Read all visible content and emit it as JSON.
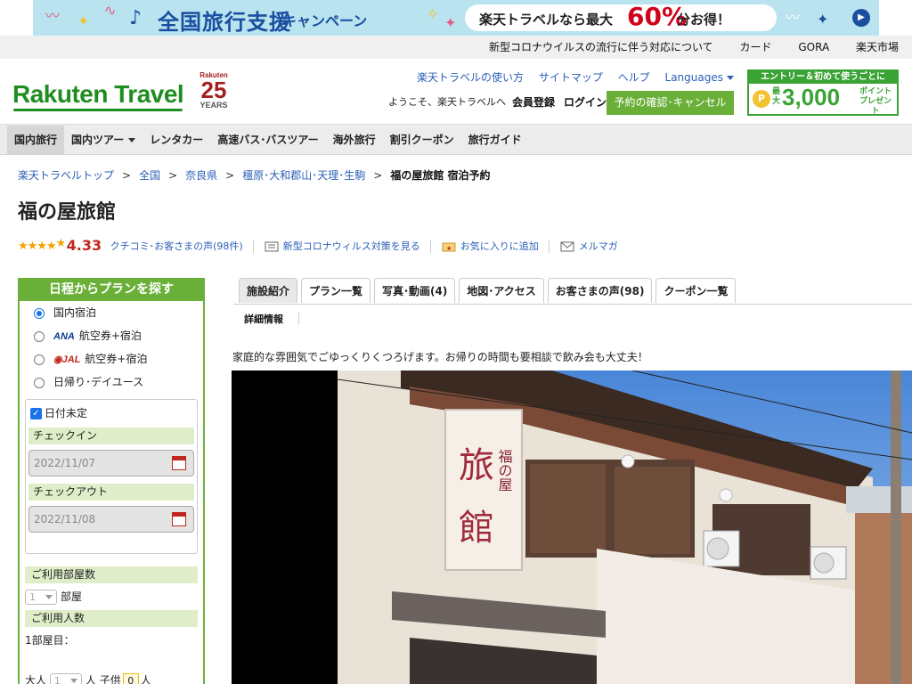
{
  "banner": {
    "title": "全国旅行支援",
    "campaign": "キャンペーン",
    "pill_prefix": "楽天トラベルなら最大",
    "pill_percent": "60%",
    "pill_suffix": "分お得！"
  },
  "toplinks": [
    "新型コロナウイルスの流行に伴う対応について",
    "カード",
    "GORA",
    "楽天市場"
  ],
  "header": {
    "logo": "Rakuten Travel",
    "years_brand": "Rakuten",
    "years_number": "25",
    "years_label": "YEARS",
    "links": [
      "楽天トラベルの使い方",
      "サイトマップ",
      "ヘルプ",
      "Languages"
    ],
    "welcome": "ようこそ、楽天トラベルへ",
    "register": "会員登録",
    "login": "ログイン",
    "confirm_button": "予約の確認･キャンセル",
    "promo_top": "エントリー＆初めて使うごとに",
    "promo_small1": "最大",
    "promo_amount": "3,000",
    "promo_small2": "ポイントプレゼント"
  },
  "nav": [
    "国内旅行",
    "国内ツアー",
    "レンタカー",
    "高速バス･バスツアー",
    "海外旅行",
    "割引クーポン",
    "旅行ガイド"
  ],
  "breadcrumb": [
    "楽天トラベルトップ",
    "全国",
    "奈良県",
    "橿原･大和郡山･天理･生駒"
  ],
  "breadcrumb_current": "福の屋旅館 宿泊予約",
  "hotel": {
    "name": "福の屋旅館",
    "score": "4.33",
    "rating_fraction": 0.866,
    "reviews_link": "クチコミ･お客さまの声(98件)",
    "covid_link": "新型コロナウィルス対策を見る",
    "favorite_link": "お気に入りに追加",
    "mailmag_link": "メルマガ",
    "catchphrase": "家庭的な雰囲気でごゆっくりくつろげます。お帰りの時間も要相談で飲み会も大丈夫！"
  },
  "sidebar": {
    "title": "日程からプランを探す",
    "options": [
      {
        "label": "国内宿泊",
        "selected": true
      },
      {
        "logo": "ANA",
        "label": "航空券+宿泊",
        "selected": false
      },
      {
        "logo": "JAL",
        "label": "航空券+宿泊",
        "selected": false
      },
      {
        "label": "日帰り･デイユース",
        "selected": false
      }
    ],
    "date_undecided": "日付未定",
    "checkin_label": "チェックイン",
    "checkin_value": "2022/11/07",
    "checkout_label": "チェックアウト",
    "checkout_value": "2022/11/08",
    "rooms_label": "ご利用部屋数",
    "rooms_value": "1",
    "rooms_unit": "部屋",
    "guests_label": "ご利用人数",
    "room1_label": "1部屋目：",
    "adult_label": "大人",
    "adult_value": "1",
    "adult_unit": "人",
    "child_label": "子供",
    "child_value": "0",
    "child_unit": "人"
  },
  "tabs": [
    "施設紹介",
    "プラン一覧",
    "写真･動画(4)",
    "地図･アクセス",
    "お客さまの声(98)",
    "クーポン一覧"
  ],
  "subtab": "詳細情報",
  "photo": {
    "sign_small": "福の屋",
    "sign_big1": "旅",
    "sign_big2": "館"
  }
}
